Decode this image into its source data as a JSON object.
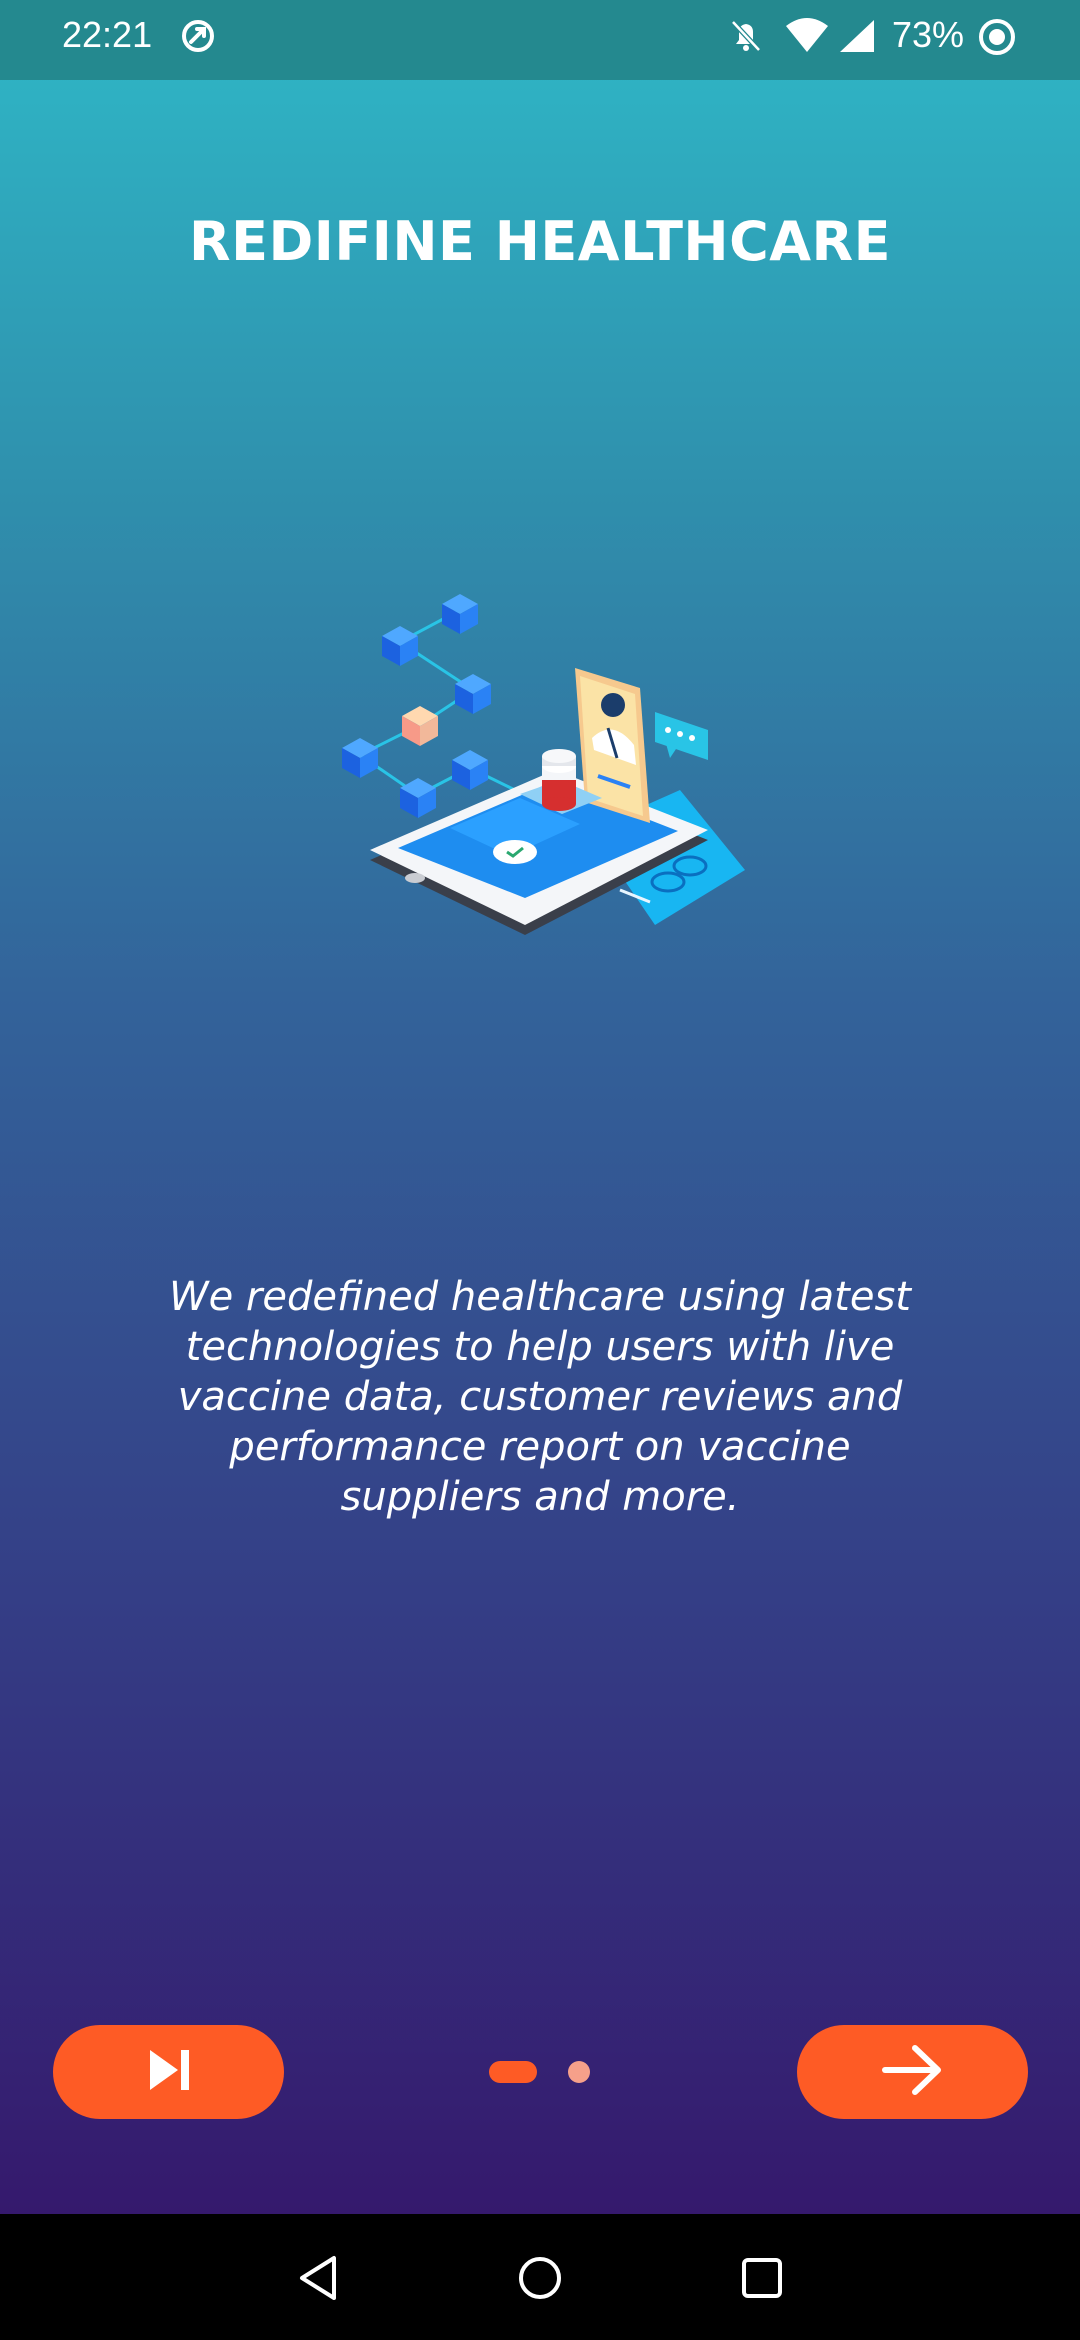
{
  "status_bar": {
    "time": "22:21",
    "battery": "73%",
    "icons": [
      "sync-icon",
      "bell-off-icon",
      "wifi-icon",
      "signal-icon",
      "battery-icon"
    ]
  },
  "onboarding": {
    "title": "REDIFINE HEALTHCARE",
    "description": "We redefined healthcare using latest technologies to help users with live vaccine data, customer reviews and performance report on vaccine suppliers and more.",
    "illustration": "digital-healthcare-illustration",
    "page_indicator": {
      "current": 1,
      "total": 2
    }
  },
  "buttons": {
    "skip_icon": "skip-next-icon",
    "next_icon": "arrow-right-icon"
  },
  "nav_bar": {
    "icons": [
      "back-icon",
      "home-icon",
      "recents-icon"
    ]
  },
  "colors": {
    "accent": "#fe5b25",
    "status_bar": "#24898f",
    "gradient_top": "#2fb8c7",
    "gradient_bottom": "#35196d",
    "inactive_dot": "#f6a08a"
  }
}
